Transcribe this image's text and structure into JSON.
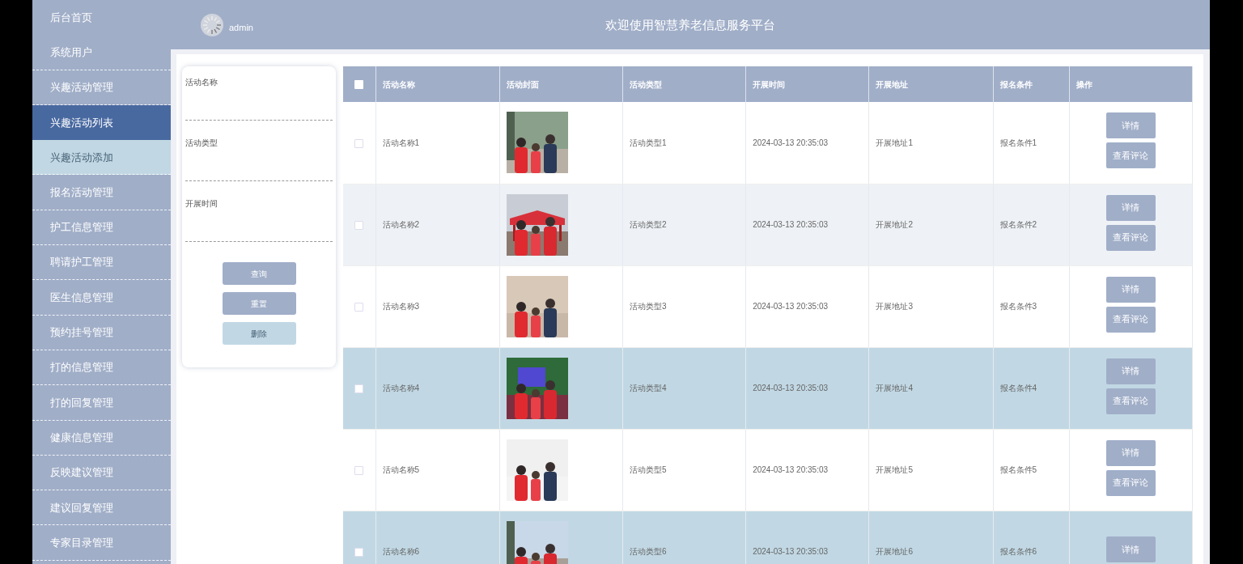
{
  "header": {
    "username": "admin",
    "title": "欢迎使用智慧养老信息服务平台"
  },
  "sidebar": {
    "items": [
      {
        "label": "后台首页",
        "selected": false
      },
      {
        "label": "系统用户",
        "selected": false
      },
      {
        "label": "兴趣活动管理",
        "selected": false,
        "children": [
          {
            "label": "兴趣活动列表",
            "selected": true
          },
          {
            "label": "兴趣活动添加",
            "selected": false
          }
        ]
      },
      {
        "label": "报名活动管理",
        "selected": false
      },
      {
        "label": "护工信息管理",
        "selected": false
      },
      {
        "label": "聘请护工管理",
        "selected": false
      },
      {
        "label": "医生信息管理",
        "selected": false
      },
      {
        "label": "预约挂号管理",
        "selected": false
      },
      {
        "label": "打的信息管理",
        "selected": false
      },
      {
        "label": "打的回复管理",
        "selected": false
      },
      {
        "label": "健康信息管理",
        "selected": false
      },
      {
        "label": "反映建议管理",
        "selected": false
      },
      {
        "label": "建议回复管理",
        "selected": false
      },
      {
        "label": "专家目录管理",
        "selected": false
      }
    ]
  },
  "search": {
    "fields": [
      {
        "label": "活动名称"
      },
      {
        "label": "活动类型"
      },
      {
        "label": "开展时间"
      }
    ],
    "buttons": [
      {
        "label": "查询",
        "disabled": false
      },
      {
        "label": "重置",
        "disabled": false
      },
      {
        "label": "删除",
        "disabled": true
      }
    ]
  },
  "table": {
    "select_all_checked": false,
    "columns": [
      "活动名称",
      "活动封面",
      "活动类型",
      "开展时间",
      "开展地址",
      "报名条件",
      "操作"
    ],
    "rows": [
      {
        "checked": false,
        "highlighted": false,
        "name": "活动名称1",
        "cover": {
          "kind": "picture"
        },
        "type": "活动类型1",
        "time": "2024-03-13 20:35:03",
        "address": "开展地址1",
        "condition": "报名条件1",
        "buttons": [
          "详情",
          "查看评论"
        ]
      },
      {
        "checked": false,
        "highlighted": false,
        "name": "活动名称2",
        "cover": {
          "kind": "picture"
        },
        "type": "活动类型2",
        "time": "2024-03-13 20:35:03",
        "address": "开展地址2",
        "condition": "报名条件2",
        "buttons": [
          "详情",
          "查看评论"
        ]
      },
      {
        "checked": false,
        "highlighted": false,
        "name": "活动名称3",
        "cover": {
          "kind": "picture"
        },
        "type": "活动类型3",
        "time": "2024-03-13 20:35:03",
        "address": "开展地址3",
        "condition": "报名条件3",
        "buttons": [
          "详情",
          "查看评论"
        ]
      },
      {
        "checked": false,
        "highlighted": true,
        "name": "活动名称4",
        "cover": {
          "kind": "picture"
        },
        "type": "活动类型4",
        "time": "2024-03-13 20:35:03",
        "address": "开展地址4",
        "condition": "报名条件4",
        "buttons": [
          "详情",
          "查看评论"
        ]
      },
      {
        "checked": false,
        "highlighted": false,
        "name": "活动名称5",
        "cover": {
          "kind": "picture"
        },
        "type": "活动类型5",
        "time": "2024-03-13 20:35:03",
        "address": "开展地址5",
        "condition": "报名条件5",
        "buttons": [
          "详情",
          "查看评论"
        ]
      },
      {
        "checked": false,
        "highlighted": true,
        "name": "活动名称6",
        "cover": {
          "kind": "picture"
        },
        "type": "活动类型6",
        "time": "2024-03-13 20:35:03",
        "address": "开展地址6",
        "condition": "报名条件6",
        "buttons": [
          "详情"
        ]
      }
    ]
  }
}
